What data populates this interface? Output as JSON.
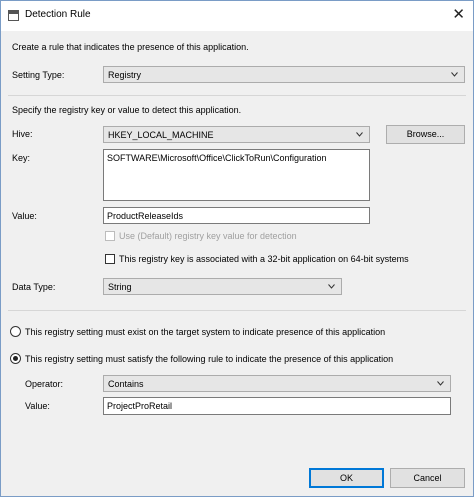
{
  "window": {
    "title": "Detection Rule",
    "close_icon": "close-icon"
  },
  "intro": "Create a rule that indicates the presence of this application.",
  "setting_type": {
    "label": "Setting Type:",
    "value": "Registry"
  },
  "specify": "Specify the registry key or value to detect this application.",
  "hive": {
    "label": "Hive:",
    "value": "HKEY_LOCAL_MACHINE",
    "browse": "Browse..."
  },
  "key": {
    "label": "Key:",
    "value": "SOFTWARE\\Microsoft\\Office\\ClickToRun\\Configuration"
  },
  "value": {
    "label": "Value:",
    "value": "ProductReleaseIds"
  },
  "use_default": {
    "label": "Use (Default) registry key value for detection",
    "checked": false,
    "enabled": false
  },
  "is32bit": {
    "label": "This registry key is associated with a 32-bit application on 64-bit systems",
    "checked": false
  },
  "data_type": {
    "label": "Data Type:",
    "value": "String"
  },
  "radio_exist": {
    "label": "This registry setting must exist on the target system to indicate presence of this application",
    "selected": false
  },
  "radio_rule": {
    "label": "This registry setting must satisfy the following rule to indicate the presence of this application",
    "selected": true
  },
  "operator": {
    "label": "Operator:",
    "value": "Contains"
  },
  "rule_value": {
    "label": "Value:",
    "value": "ProjectProRetail"
  },
  "buttons": {
    "ok": "OK",
    "cancel": "Cancel"
  }
}
